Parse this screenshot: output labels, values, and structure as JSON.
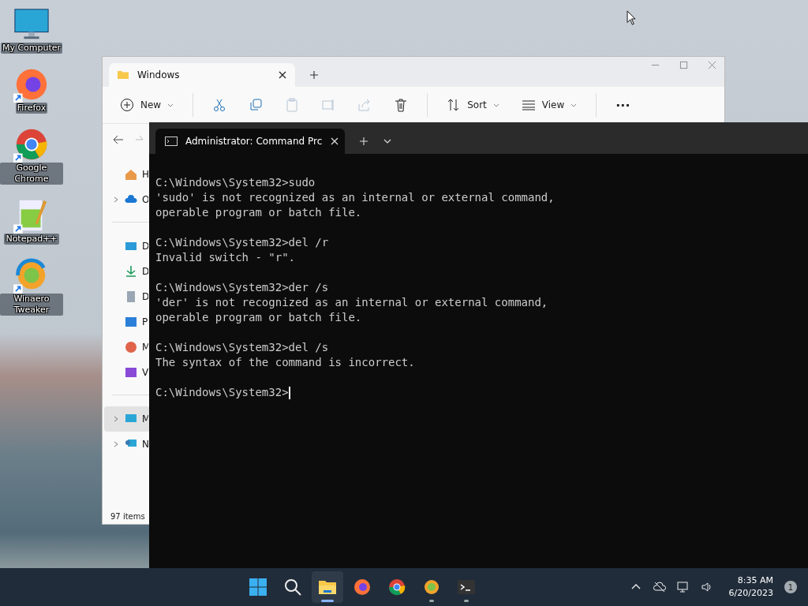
{
  "desktop_icons": [
    {
      "label": "My Computer",
      "kind": "monitor",
      "shortcut": false
    },
    {
      "label": "Firefox",
      "kind": "firefox",
      "shortcut": true
    },
    {
      "label": "Google Chrome",
      "kind": "chrome",
      "shortcut": true
    },
    {
      "label": "Notepad++",
      "kind": "notepad",
      "shortcut": true
    },
    {
      "label": "Winaero Tweaker",
      "kind": "winaero",
      "shortcut": true
    }
  ],
  "explorer": {
    "tab_title": "Windows",
    "toolbar": [
      {
        "kind": "new",
        "label": "New",
        "disabled": false
      },
      {
        "kind": "cut",
        "disabled": false
      },
      {
        "kind": "copy",
        "disabled": false
      },
      {
        "kind": "paste",
        "disabled": true
      },
      {
        "kind": "rename",
        "disabled": true
      },
      {
        "kind": "share",
        "disabled": true
      },
      {
        "kind": "delete",
        "disabled": false
      },
      {
        "kind": "sort",
        "label": "Sort",
        "disabled": false
      },
      {
        "kind": "view",
        "label": "View",
        "disabled": false
      },
      {
        "kind": "more",
        "label": "···",
        "disabled": false
      }
    ],
    "sidebar_groups": [
      [
        {
          "label": "H",
          "kind": "home",
          "expandable": false,
          "selected": false
        },
        {
          "label": "O",
          "kind": "cloud",
          "expandable": true,
          "selected": false
        }
      ],
      [
        {
          "label": "D",
          "kind": "desktop",
          "expandable": false,
          "selected": false
        },
        {
          "label": "D",
          "kind": "download",
          "expandable": false,
          "selected": false
        },
        {
          "label": "D",
          "kind": "document",
          "expandable": false,
          "selected": false
        },
        {
          "label": "P",
          "kind": "picture",
          "expandable": false,
          "selected": false
        },
        {
          "label": "M",
          "kind": "music",
          "expandable": false,
          "selected": false
        },
        {
          "label": "V",
          "kind": "video",
          "expandable": false,
          "selected": false
        }
      ],
      [
        {
          "label": "M",
          "kind": "pc",
          "expandable": true,
          "selected": true
        },
        {
          "label": "N",
          "kind": "network",
          "expandable": true,
          "selected": false
        }
      ]
    ],
    "status": "97 items"
  },
  "terminal": {
    "tab_title": "Administrator:  Command Prc",
    "blocks": [
      [
        "C:\\Windows\\System32>sudo",
        "'sudo' is not recognized as an internal or external command,",
        "operable program or batch file."
      ],
      [
        "C:\\Windows\\System32>del /r",
        "Invalid switch - \"r\"."
      ],
      [
        "C:\\Windows\\System32>der /s",
        "'der' is not recognized as an internal or external command,",
        "operable program or batch file."
      ],
      [
        "C:\\Windows\\System32>del /s",
        "The syntax of the command is incorrect."
      ]
    ],
    "prompt": "C:\\Windows\\System32>"
  },
  "taskbar": {
    "apps": [
      {
        "kind": "start",
        "running": false,
        "active": false
      },
      {
        "kind": "search",
        "running": false,
        "active": false
      },
      {
        "kind": "explorer",
        "running": true,
        "active": true
      },
      {
        "kind": "firefox",
        "running": false,
        "active": false
      },
      {
        "kind": "chrome",
        "running": false,
        "active": false
      },
      {
        "kind": "winaero",
        "running": true,
        "active": false
      },
      {
        "kind": "terminal",
        "running": true,
        "active": false
      }
    ],
    "time": "8:35 AM",
    "date": "6/20/2023",
    "notifications": "1"
  }
}
